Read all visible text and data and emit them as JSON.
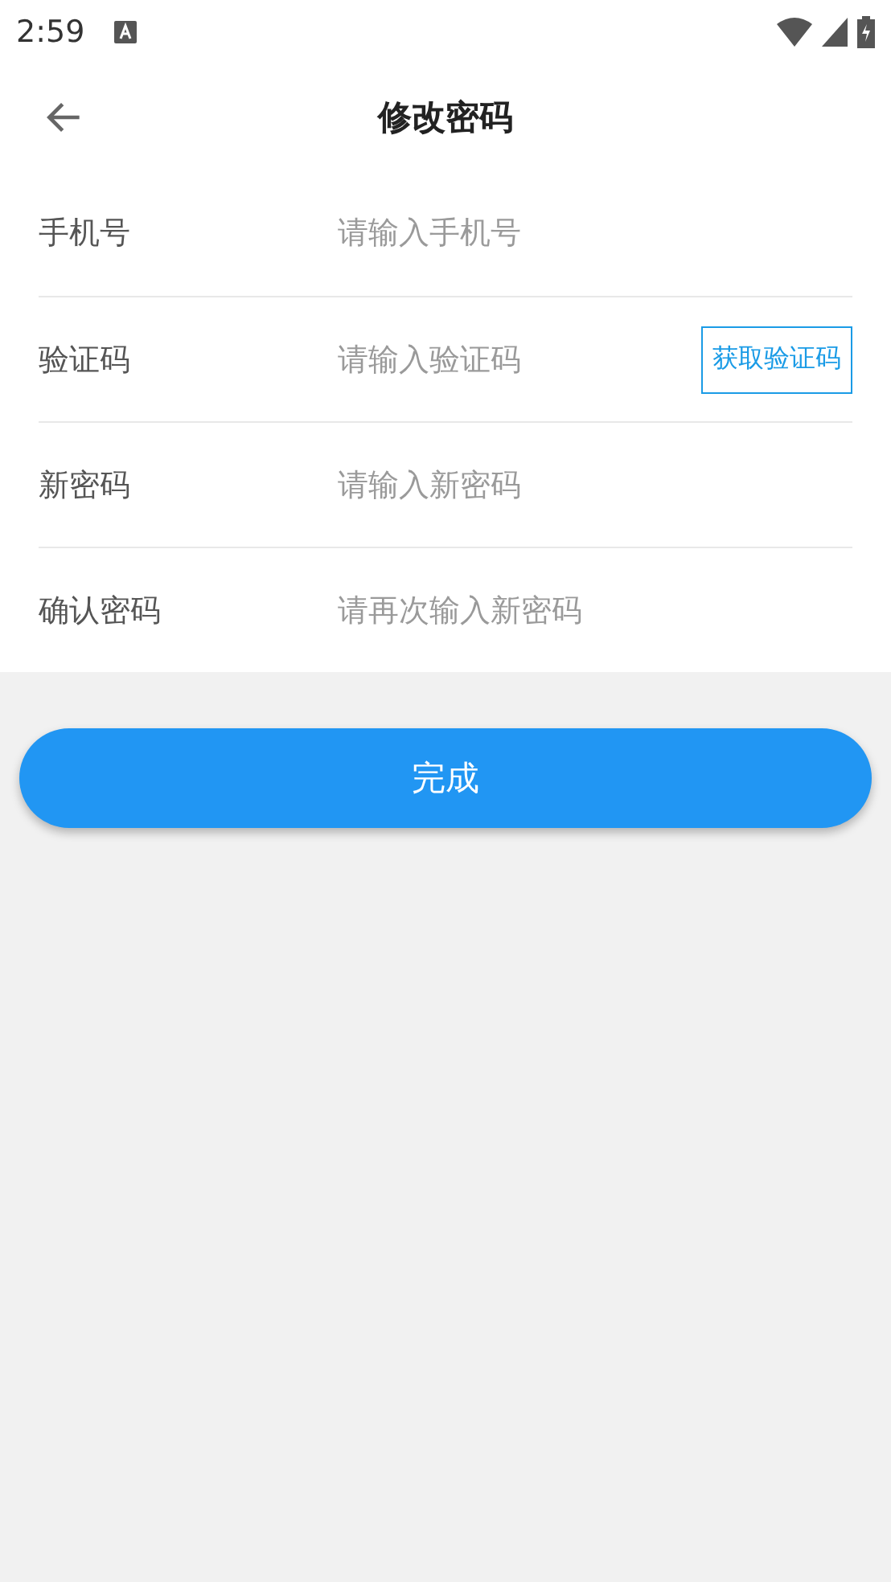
{
  "status_bar": {
    "time": "2:59"
  },
  "header": {
    "title": "修改密码"
  },
  "fields": [
    {
      "kind": "plain",
      "label": "手机号",
      "placeholder": "请输入手机号"
    },
    {
      "kind": "code",
      "label": "验证码",
      "placeholder": "请输入验证码",
      "action": "获取验证码"
    },
    {
      "kind": "plain",
      "label": "新密码",
      "placeholder": "请输入新密码"
    },
    {
      "kind": "plain",
      "label": "确认密码",
      "placeholder": "请再次输入新密码"
    }
  ],
  "submit": "完成"
}
